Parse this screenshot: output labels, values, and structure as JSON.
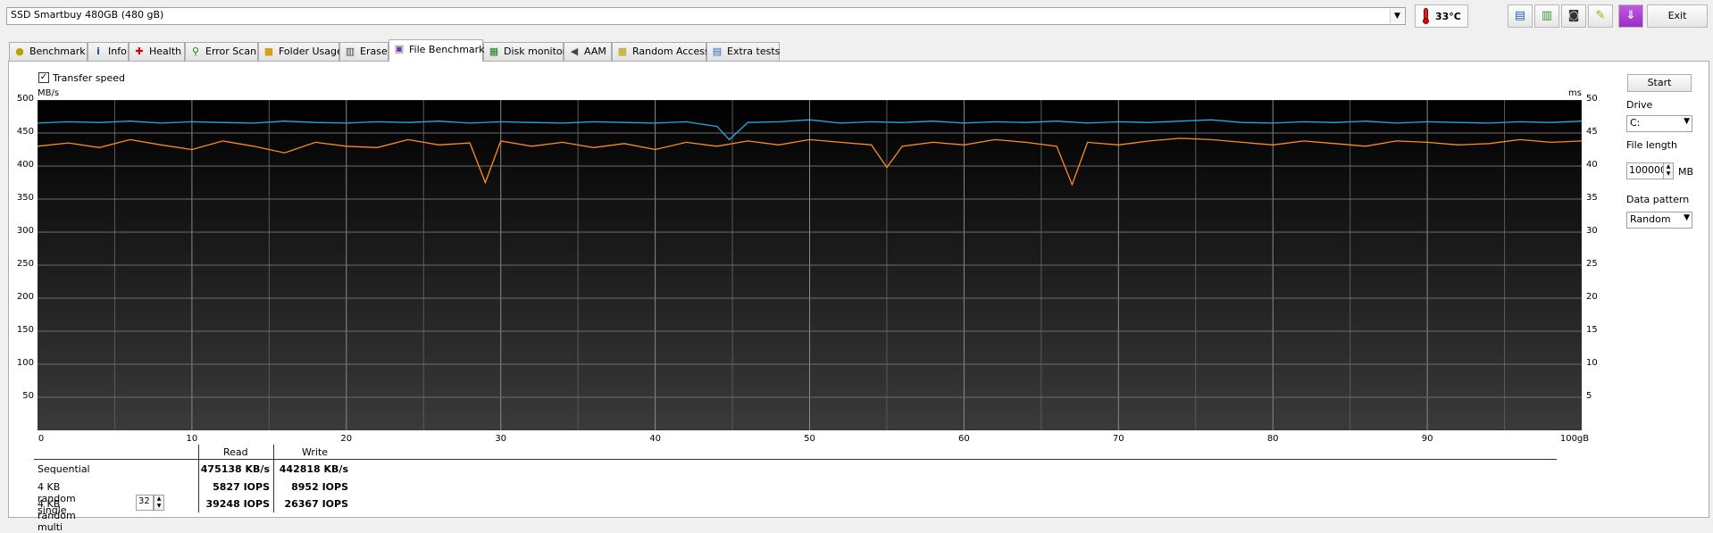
{
  "window": {
    "drive_select": "SSD Smartbuy 480GB (480 gB)",
    "temperature": "33°C",
    "toolbar_icons": [
      "copy-text-icon",
      "copy-image-icon",
      "screenshot-icon",
      "options-icon",
      "save-icon"
    ],
    "exit_label": "Exit"
  },
  "tabs": [
    {
      "label": "Benchmark",
      "icon": "benchmark-icon",
      "active": false
    },
    {
      "label": "Info",
      "icon": "info-icon",
      "active": false
    },
    {
      "label": "Health",
      "icon": "health-icon",
      "active": false
    },
    {
      "label": "Error Scan",
      "icon": "error-scan-icon",
      "active": false
    },
    {
      "label": "Folder Usage",
      "icon": "folder-icon",
      "active": false
    },
    {
      "label": "Erase",
      "icon": "erase-icon",
      "active": false
    },
    {
      "label": "File Benchmark",
      "icon": "file-benchmark-icon",
      "active": true
    },
    {
      "label": "Disk monitor",
      "icon": "disk-monitor-icon",
      "active": false
    },
    {
      "label": "AAM",
      "icon": "aam-icon",
      "active": false
    },
    {
      "label": "Random Access",
      "icon": "random-access-icon",
      "active": false
    },
    {
      "label": "Extra tests",
      "icon": "extra-tests-icon",
      "active": false
    }
  ],
  "transfer_speed": {
    "label": "Transfer speed",
    "checked": true
  },
  "controls": {
    "start_label": "Start",
    "drive_label": "Drive",
    "drive_value": "C:",
    "file_length_label": "File length",
    "file_length_value": "100000",
    "file_length_unit": "MB",
    "data_pattern_label": "Data pattern",
    "data_pattern_value": "Random"
  },
  "results": {
    "read_header": "Read",
    "write_header": "Write",
    "rows": [
      {
        "label": "Sequential",
        "read": "475138 KB/s",
        "write": "442818 KB/s"
      },
      {
        "label": "4 KB random single",
        "read": "5827 IOPS",
        "write": "8952 IOPS"
      },
      {
        "label": "4 KB random multi",
        "read": "39248 IOPS",
        "write": "26367 IOPS"
      }
    ],
    "queue_depth": "32"
  },
  "chart_data": {
    "type": "line",
    "left_unit": "MB/s",
    "right_unit": "ms",
    "x_unit_label": "100gB",
    "xlim": [
      0,
      100
    ],
    "ylim_left": [
      0,
      500
    ],
    "ylim_right": [
      0,
      50
    ],
    "y_ticks_left": [
      "500",
      "450",
      "400",
      "350",
      "300",
      "250",
      "200",
      "150",
      "100",
      "50"
    ],
    "y_ticks_right": [
      "50",
      "45",
      "40",
      "35",
      "30",
      "25",
      "20",
      "15",
      "10",
      "5"
    ],
    "x_ticks": [
      "0",
      "10",
      "20",
      "30",
      "40",
      "50",
      "60",
      "70",
      "80",
      "90",
      "100gB"
    ],
    "grid": true,
    "background": "#000000",
    "series": [
      {
        "color": "#29a9e0",
        "x": [
          0,
          2,
          4,
          6,
          8,
          10,
          12,
          14,
          16,
          18,
          20,
          22,
          24,
          26,
          28,
          30,
          32,
          34,
          36,
          38,
          40,
          42,
          44,
          44.8,
          46,
          48,
          50,
          52,
          54,
          56,
          58,
          60,
          62,
          64,
          66,
          68,
          70,
          72,
          74,
          76,
          78,
          80,
          82,
          84,
          86,
          88,
          90,
          92,
          94,
          96,
          98,
          100
        ],
        "values": [
          465,
          467,
          466,
          468,
          465,
          467,
          466,
          465,
          468,
          466,
          465,
          467,
          466,
          468,
          465,
          467,
          466,
          465,
          467,
          466,
          465,
          467,
          460,
          440,
          466,
          467,
          470,
          465,
          467,
          466,
          468,
          465,
          467,
          466,
          468,
          465,
          467,
          466,
          468,
          470,
          466,
          465,
          467,
          466,
          468,
          465,
          467,
          466,
          465,
          467,
          466,
          468
        ]
      },
      {
        "color": "#ff8c1a",
        "x": [
          0,
          2,
          4,
          6,
          8,
          10,
          12,
          14,
          16,
          18,
          20,
          22,
          24,
          26,
          28,
          29,
          30,
          32,
          34,
          36,
          38,
          40,
          42,
          44,
          46,
          48,
          50,
          52,
          54,
          55,
          56,
          58,
          60,
          62,
          64,
          66,
          67,
          68,
          70,
          72,
          74,
          76,
          78,
          80,
          82,
          84,
          86,
          88,
          90,
          92,
          94,
          96,
          98,
          100
        ],
        "values": [
          430,
          435,
          428,
          440,
          432,
          425,
          438,
          430,
          420,
          436,
          430,
          428,
          440,
          432,
          435,
          375,
          438,
          430,
          436,
          428,
          434,
          425,
          436,
          430,
          438,
          432,
          440,
          436,
          432,
          398,
          430,
          436,
          432,
          440,
          436,
          430,
          372,
          436,
          432,
          438,
          442,
          440,
          436,
          432,
          438,
          434,
          430,
          438,
          436,
          432,
          434,
          440,
          436,
          438
        ]
      }
    ]
  }
}
